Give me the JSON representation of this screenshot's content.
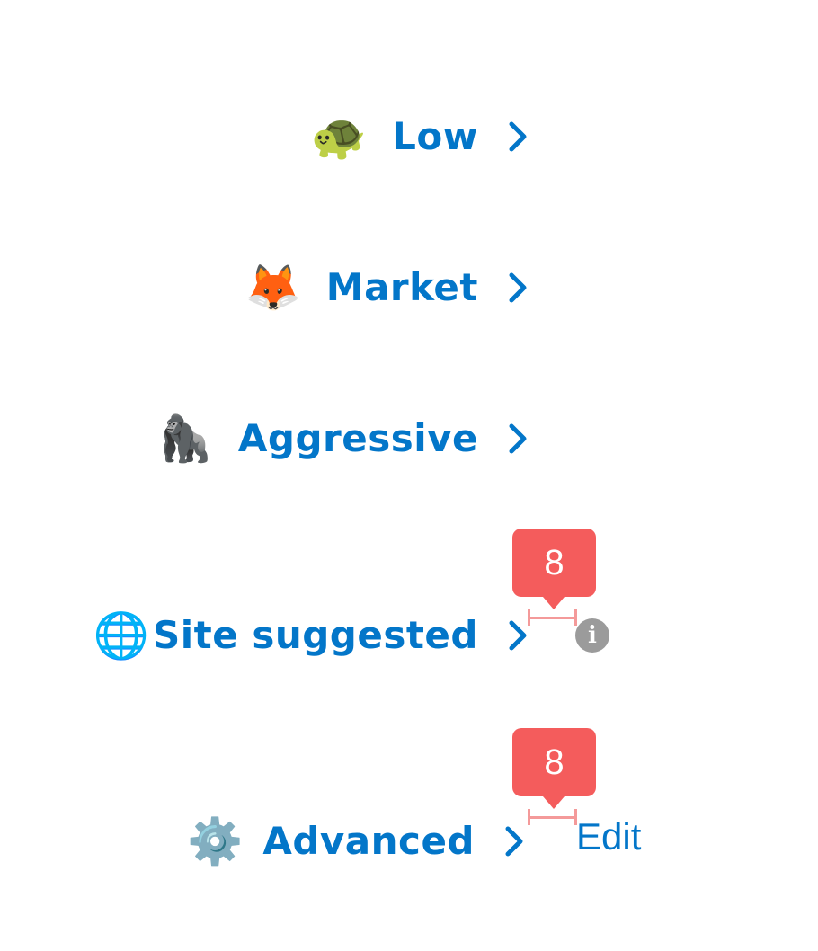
{
  "options": [
    {
      "id": "low",
      "icon": "turtle-icon",
      "emoji": "🐢",
      "label": "Low"
    },
    {
      "id": "market",
      "icon": "fox-icon",
      "emoji": "🦊",
      "label": "Market"
    },
    {
      "id": "aggressive",
      "icon": "gorilla-icon",
      "emoji": "🦍",
      "label": "Aggressive"
    },
    {
      "id": "site_suggested",
      "icon": "globe-icon",
      "emoji": "🌐",
      "label": "Site suggested"
    },
    {
      "id": "advanced",
      "icon": "gear-icon",
      "emoji": "⚙️",
      "label": "Advanced"
    }
  ],
  "advanced": {
    "edit_label": "Edit"
  },
  "info": {
    "icon": "info-icon",
    "glyph": "i"
  },
  "measurements": [
    {
      "target": "site_suggested",
      "value": "8"
    },
    {
      "target": "advanced",
      "value": "8"
    }
  ],
  "colors": {
    "link": "#0376c9",
    "badge": "#f45c5c",
    "measure_line": "#f49a9a",
    "info": "#9b9b9b"
  }
}
